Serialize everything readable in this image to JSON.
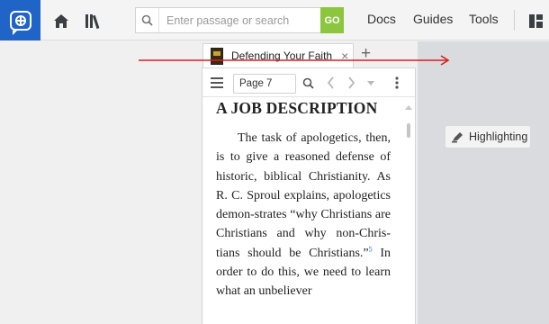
{
  "topbar": {
    "search_placeholder": "Enter passage or search",
    "go_label": "GO",
    "nav": {
      "docs": "Docs",
      "guides": "Guides",
      "tools": "Tools"
    },
    "brand_color": "#1f64c6",
    "go_color": "#8cc63f"
  },
  "tab": {
    "title": "Defending Your Faith",
    "close_glyph": "×",
    "add_glyph": "+"
  },
  "reader": {
    "page_value": "Page 7",
    "heading": "A JOB DESCRIPTION",
    "paragraph_before_note": "The task of apologetics, then, is to give a reasoned defense of historic, biblical Christianity. As R. C. Sproul explains, apologetics demon-strates “why Christians are Christians and why non-Chris-tians should be Christians.”",
    "footnote_ref": "5",
    "paragraph_after_note": " In order to do this, we need to learn what an unbeliever"
  },
  "side_panel": {
    "highlighting_label": "Highlighting"
  },
  "annotation": {
    "arrow_color": "#d62020"
  }
}
